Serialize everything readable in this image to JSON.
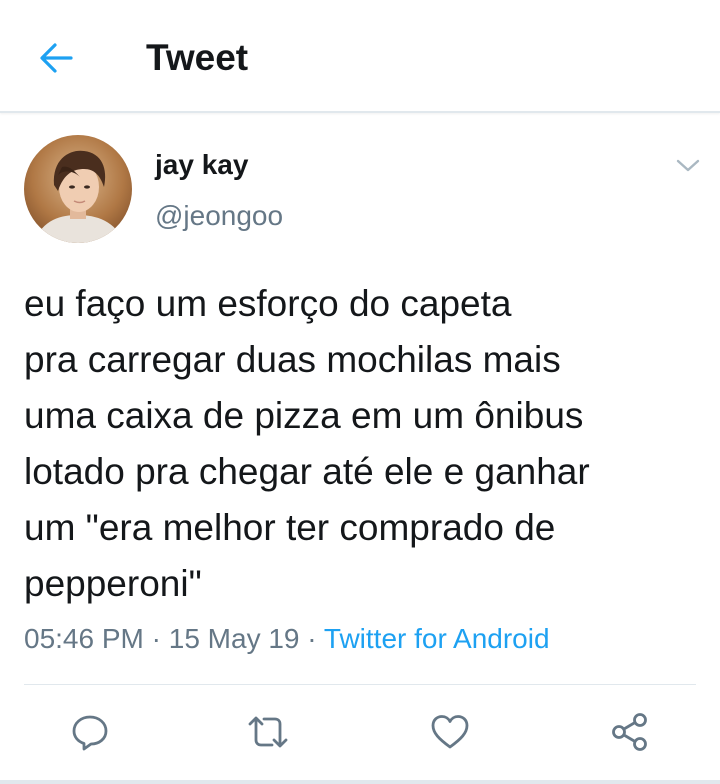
{
  "header": {
    "title": "Tweet",
    "back_icon": "arrow-left-icon"
  },
  "tweet": {
    "author": {
      "display_name": "jay kay",
      "handle": "@jeongoo"
    },
    "text": "eu faço um esforço do capeta\npra carregar duas mochilas mais\numa caixa de pizza em um ônibus\nlotado pra chegar até ele e ganhar\num \"era melhor ter comprado de\npepperoni\"",
    "time": "05:46 PM",
    "separator": "·",
    "date": "15 May 19",
    "source": "Twitter for Android"
  },
  "actions": {
    "reply_icon": "reply-icon",
    "retweet_icon": "retweet-icon",
    "like_icon": "heart-icon",
    "share_icon": "share-icon"
  },
  "colors": {
    "accent": "#1da1f2",
    "text_primary": "#14171a",
    "text_secondary": "#657786",
    "divider": "#e1e8ed"
  }
}
